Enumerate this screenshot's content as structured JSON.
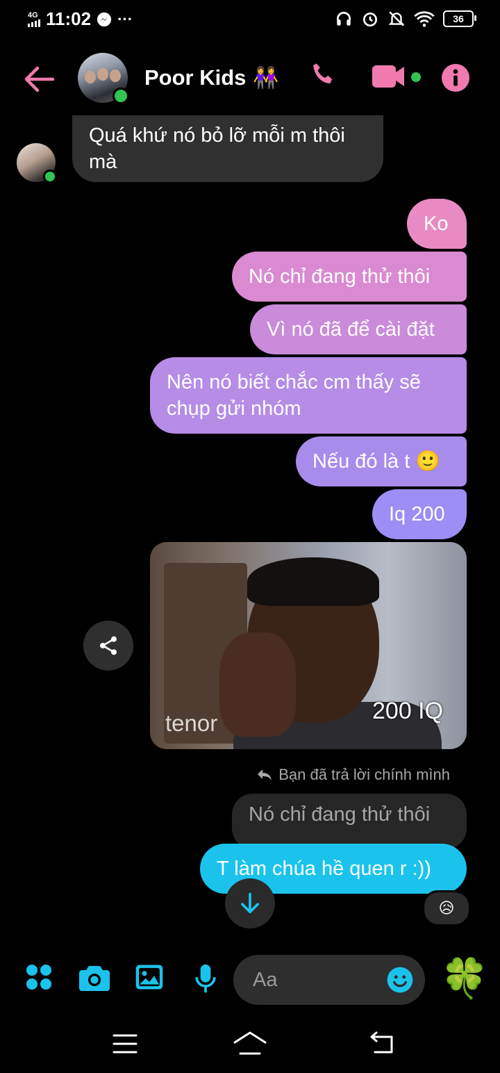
{
  "status_bar": {
    "network": "4G",
    "time": "11:02",
    "more": "···",
    "battery": "36"
  },
  "header": {
    "title": "Poor Kids",
    "title_emoji": "👭"
  },
  "messages": {
    "m1": "Quá khứ nó bỏ lỡ mỗi m thôi mà",
    "m2": "Ko",
    "m3": "Nó chỉ đang thử thôi",
    "m4": "Vì nó đã để cài đặt",
    "m5": "Nên nó biết chắc cm thấy sẽ chụp gửi nhóm",
    "m6": "Nếu đó là t 🙂",
    "m7": "Iq 200"
  },
  "gif": {
    "watermark": "tenor",
    "caption": "200 IQ"
  },
  "reply": {
    "label": "Bạn đã trả lời chính mình",
    "quoted": "Nó chỉ đang thử thôi",
    "message": "T làm chúa hề quen r :))",
    "reaction": "😥"
  },
  "composer": {
    "placeholder": "Aa",
    "sticker": "🍀"
  },
  "colors": {
    "accent_pink": "#f07aae",
    "accent_cyan": "#1bc3ec",
    "bubble_received": "#303030",
    "online_green": "#31c454"
  },
  "icons": [
    "back-arrow-icon",
    "phone-icon",
    "video-camera-icon",
    "info-icon",
    "share-icon",
    "reply-icon",
    "scroll-down-icon",
    "menu-dots-icon",
    "camera-icon",
    "gallery-icon",
    "microphone-icon",
    "emoji-icon",
    "nav-menu-icon",
    "nav-home-icon",
    "nav-back-icon"
  ]
}
